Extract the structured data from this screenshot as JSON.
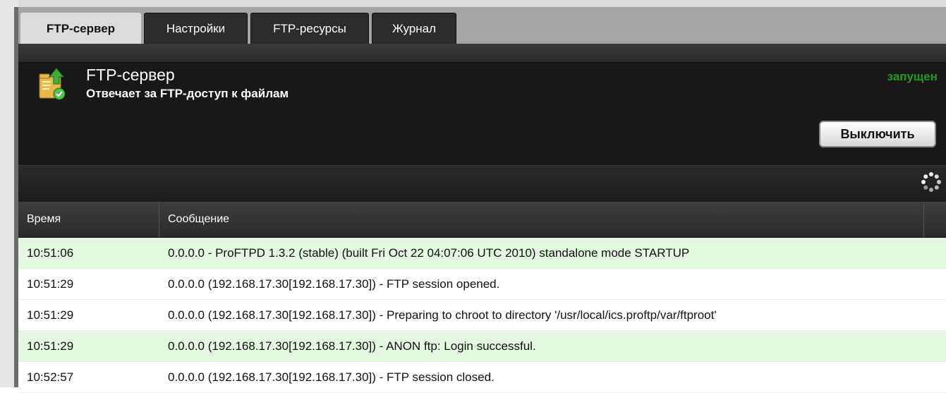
{
  "tabs": [
    {
      "label": "FTP-сервер",
      "active": true
    },
    {
      "label": "Настройки",
      "active": false
    },
    {
      "label": "FTP-ресурсы",
      "active": false
    },
    {
      "label": "Журнал",
      "active": false
    }
  ],
  "service": {
    "title": "FTP-сервер",
    "subtitle": "Отвечает за FTP-доступ к файлам",
    "status": "запущен",
    "status_color": "#1f9d1f",
    "action_label": "Выключить",
    "icon": "ftp-folder-check-icon"
  },
  "toolbar": {
    "refresh_icon": "refresh-spinner-icon"
  },
  "log_table": {
    "columns": {
      "time": "Время",
      "message": "Сообщение"
    },
    "highlight_color": "#e2f8df",
    "rows": [
      {
        "time": "10:51:06",
        "message": "0.0.0.0 - ProFTPD 1.3.2 (stable) (built Fri Oct 22 04:07:06 UTC 2010) standalone mode STARTUP",
        "highlight": true
      },
      {
        "time": "10:51:29",
        "message": "0.0.0.0 (192.168.17.30[192.168.17.30]) - FTP session opened.",
        "highlight": false
      },
      {
        "time": "10:51:29",
        "message": "0.0.0.0 (192.168.17.30[192.168.17.30]) - Preparing to chroot to directory '/usr/local/ics.proftp/var/ftproot'",
        "highlight": false
      },
      {
        "time": "10:51:29",
        "message": "0.0.0.0 (192.168.17.30[192.168.17.30]) - ANON ftp: Login successful.",
        "highlight": true
      },
      {
        "time": "10:52:57",
        "message": "0.0.0.0 (192.168.17.30[192.168.17.30]) - FTP session closed.",
        "highlight": false
      }
    ]
  }
}
